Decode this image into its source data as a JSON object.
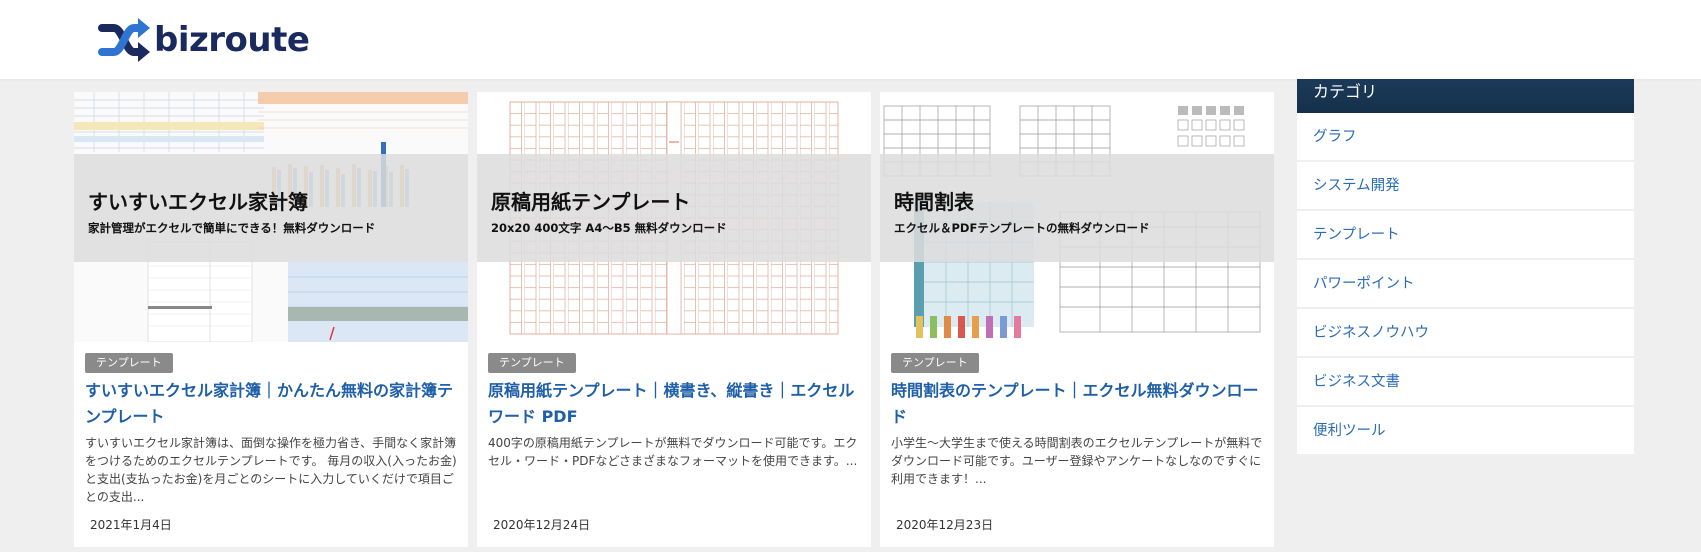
{
  "site": {
    "logo_text": "bizroute",
    "brand_color": "#1a2a5e"
  },
  "cards": [
    {
      "thumb_title": "すいすいエクセル家計簿",
      "thumb_sub": "家計管理がエクセルで簡単にできる！無料ダウンロード",
      "badge": "テンプレート",
      "title": "すいすいエクセル家計簿｜かんたん無料の家計簿テンプレート",
      "desc": "すいすいエクセル家計簿は、面倒な操作を極力省き、手間なく家計簿をつけるためのエクセルテンプレートです。 毎月の収入(入ったお金)と支出(支払ったお金)を月ごとのシートに入力していくだけで項目ごとの支出...",
      "date": "2021年1月4日"
    },
    {
      "thumb_title": "原稿用紙テンプレート",
      "thumb_sub": "20x20 400文字 A4〜B5 無料ダウンロード",
      "badge": "テンプレート",
      "title": "原稿用紙テンプレート｜横書き、縦書き｜エクセル ワード PDF",
      "desc": "400字の原稿用紙テンプレートが無料でダウンロード可能です。エクセル・ワード・PDFなどさまざまなフォーマットを使用できます。...",
      "date": "2020年12月24日"
    },
    {
      "thumb_title": "時間割表",
      "thumb_sub": "エクセル＆PDFテンプレートの無料ダウンロード",
      "badge": "テンプレート",
      "title": "時間割表のテンプレート｜エクセル無料ダウンロード",
      "desc": "小学生〜大学生まで使える時間割表のエクセルテンプレートが無料でダウンロード可能です。ユーザー登録やアンケートなしなのですぐに利用できます！...",
      "date": "2020年12月23日"
    }
  ],
  "sidebar": {
    "heading": "カテゴリ",
    "items": [
      "グラフ",
      "システム開発",
      "テンプレート",
      "パワーポイント",
      "ビジネスノウハウ",
      "ビジネス文書",
      "便利ツール"
    ]
  }
}
